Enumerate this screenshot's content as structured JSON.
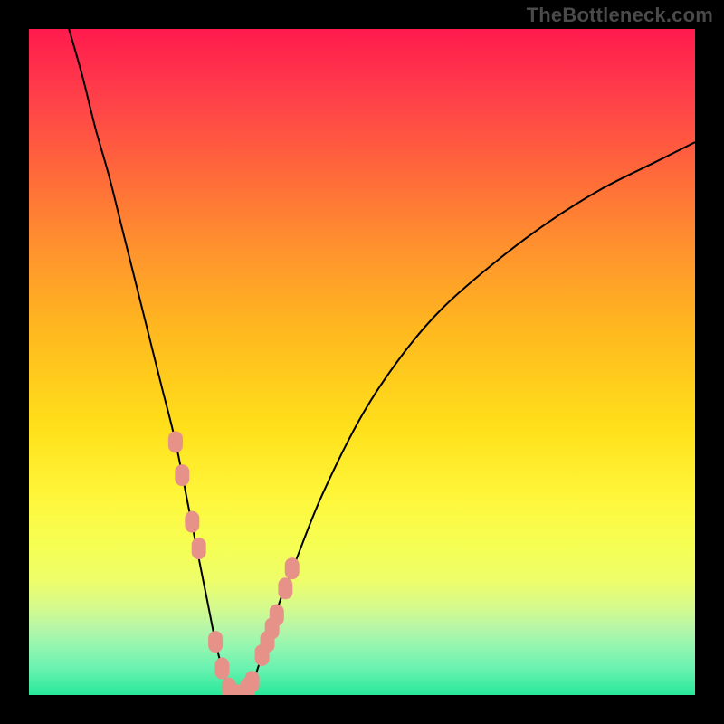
{
  "watermark": "TheBottleneck.com",
  "chart_data": {
    "type": "line",
    "title": "",
    "xlabel": "",
    "ylabel": "",
    "xlim": [
      0,
      100
    ],
    "ylim": [
      0,
      100
    ],
    "legend": false,
    "grid": false,
    "background_gradient": {
      "top_color": "#ff1a4d",
      "bottom_color": "#28e899",
      "description": "vertical red-to-green gradient indicating high (red) to low (green) bottleneck"
    },
    "series": [
      {
        "name": "bottleneck-curve",
        "stroke": "#000000",
        "stroke_width": 2,
        "x": [
          6,
          8,
          10,
          12,
          14,
          16,
          18,
          20,
          22,
          24,
          25,
          26,
          27,
          28,
          29,
          30,
          31,
          32,
          33,
          34,
          35,
          36,
          38,
          40,
          44,
          50,
          56,
          62,
          70,
          78,
          86,
          94,
          100
        ],
        "y": [
          100,
          93,
          85,
          78,
          70,
          62,
          54,
          46,
          38,
          28,
          23,
          18,
          13,
          8,
          4,
          1,
          0,
          0,
          1,
          3,
          6,
          9,
          15,
          20,
          30,
          42,
          51,
          58,
          65,
          71,
          76,
          80,
          83
        ]
      },
      {
        "name": "highlight-markers",
        "type": "scatter",
        "marker_color": "#e79289",
        "marker_shape": "rounded-rect",
        "x": [
          22.0,
          23.0,
          24.5,
          25.5,
          28.0,
          29.0,
          30.0,
          31.0,
          32.0,
          32.8,
          33.5,
          35.0,
          35.8,
          36.5,
          37.2,
          38.5,
          39.5
        ],
        "y": [
          38,
          33,
          26,
          22,
          8,
          4,
          1,
          0,
          0,
          1,
          2,
          6,
          8,
          10,
          12,
          16,
          19
        ]
      }
    ]
  }
}
